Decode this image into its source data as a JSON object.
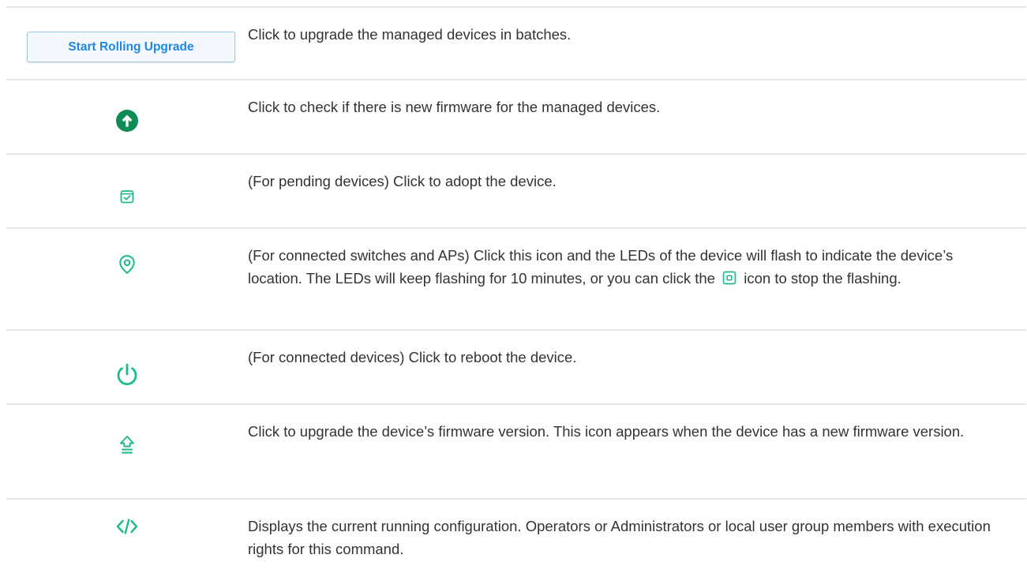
{
  "colors": {
    "accent_green": "#1fb98c",
    "dark_green": "#0e8c57",
    "button_text": "#1e88e5",
    "divider": "#e3e6ea",
    "text": "#333333"
  },
  "rows": [
    {
      "control": "button",
      "button_label": "Start Rolling Upgrade",
      "description": "Click to upgrade the managed devices in batches."
    },
    {
      "control": "check-upgrade-icon",
      "description": "Click to check if there is new firmware for the managed devices."
    },
    {
      "control": "adopt-icon",
      "description": "(For pending devices) Click to adopt the device."
    },
    {
      "control": "locate-icon",
      "description_before": "(For connected switches and APs) Click this icon and the LEDs of the device will flash to indicate the device’s location. The LEDs will keep flashing for 10 minutes, or you can click the",
      "description_after": "icon to stop the flashing.",
      "inline_icon": "stop-icon"
    },
    {
      "control": "reboot-icon",
      "description": "(For connected devices) Click to reboot the device."
    },
    {
      "control": "firmware-upgrade-icon",
      "description": "Click to upgrade the device’s firmware version. This icon appears when the device has a new firmware version."
    },
    {
      "control": "code-icon",
      "description": "Displays the current running configuration. Operators or Administrators or local user group members with execution rights for this command."
    }
  ]
}
